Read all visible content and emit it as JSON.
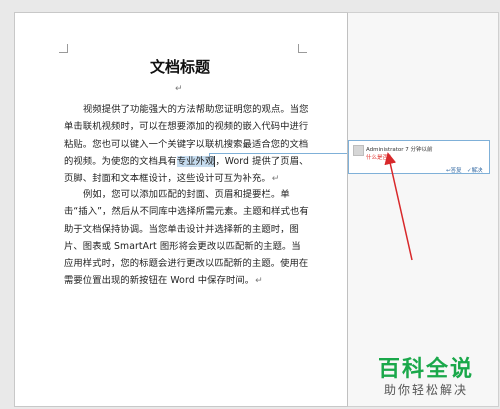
{
  "document": {
    "title": "文档标题",
    "paragraph_mark": "↵",
    "paragraph1": {
      "before_highlight": "视频提供了功能强大的方法帮助您证明您的观点。当您单击联机视频时，可以在想要添加的视频的嵌入代码中进行粘贴。您也可以键入一个关键字以联机搜索最适合您的文档的视频。为使您的文档具有",
      "highlight": "专业外观",
      "after_highlight": "，Word 提供了页眉、页脚、封面和文本框设计，这些设计可互为补充。"
    },
    "paragraph2": "例如，您可以添加匹配的封面、页眉和提要栏。单击“插入”，然后从不同库中选择所需元素。主题和样式也有助于文档保持协调。当您单击设计并选择新的主题时，图片、图表或 SmartArt 图形将会更改以匹配新的主题。当应用样式时，您的标题会进行更改以匹配新的主题。使用在需要位置出现的新按钮在 Word 中保存时间。"
  },
  "comment": {
    "author": "Administrator",
    "time": "7 分钟以前",
    "text": "什么是否？",
    "reply_label": "答复",
    "resolve_label": "解决"
  },
  "watermark": {
    "title": "百科全说",
    "subtitle": "助你轻松解决"
  },
  "colors": {
    "highlight": "#c6dcef",
    "comment_border": "#7fb0d8",
    "comment_text": "#e0302a",
    "annotation_arrow": "#d8282a",
    "watermark_green": "#1aa84a"
  }
}
